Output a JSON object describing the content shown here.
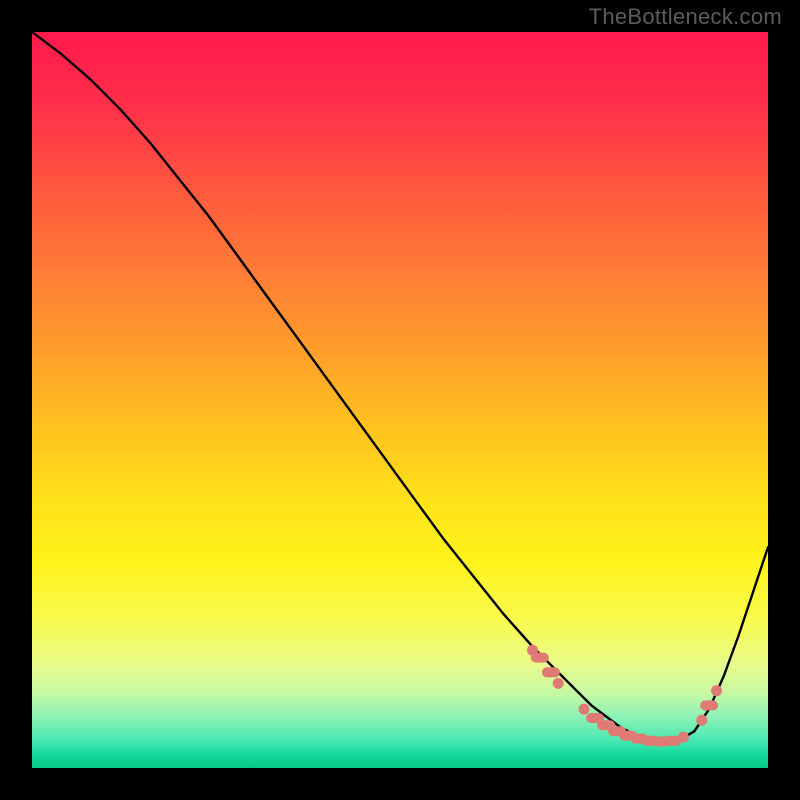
{
  "watermark": "TheBottleneck.com",
  "colors": {
    "background": "#000000",
    "curve": "#000000",
    "marker_fill": "#e07a74",
    "gradient_top": "#ff1a4d",
    "gradient_bottom": "#06c986"
  },
  "chart_data": {
    "type": "line",
    "title": "",
    "xlabel": "",
    "ylabel": "",
    "xlim": [
      0,
      100
    ],
    "ylim": [
      0,
      100
    ],
    "grid": false,
    "legend_position": "none",
    "series": [
      {
        "name": "curve",
        "x": [
          0,
          4,
          8,
          12,
          16,
          20,
          24,
          28,
          32,
          36,
          40,
          44,
          48,
          52,
          56,
          60,
          64,
          68,
          70,
          72,
          74,
          76,
          78,
          80,
          82,
          84,
          86,
          88,
          90,
          92,
          94,
          96,
          98,
          100
        ],
        "y": [
          100,
          97,
          93.5,
          89.5,
          85,
          80,
          75,
          69.5,
          64,
          58.5,
          53,
          47.5,
          42,
          36.5,
          31,
          26,
          21,
          16.5,
          14.5,
          12.5,
          10.5,
          8.5,
          7,
          5.5,
          4.5,
          3.8,
          3.5,
          3.8,
          5,
          8,
          12.5,
          18,
          24,
          30
        ]
      }
    ],
    "markers": [
      {
        "x": 68.0,
        "y": 16.0,
        "shape": "dot"
      },
      {
        "x": 69.0,
        "y": 15.0,
        "shape": "dash"
      },
      {
        "x": 70.5,
        "y": 13.0,
        "shape": "dash"
      },
      {
        "x": 71.5,
        "y": 11.5,
        "shape": "dot"
      },
      {
        "x": 75.0,
        "y": 8.0,
        "shape": "dot"
      },
      {
        "x": 76.5,
        "y": 6.8,
        "shape": "dash"
      },
      {
        "x": 78.0,
        "y": 5.8,
        "shape": "dash"
      },
      {
        "x": 79.5,
        "y": 5.0,
        "shape": "dash"
      },
      {
        "x": 81.0,
        "y": 4.4,
        "shape": "dash"
      },
      {
        "x": 82.5,
        "y": 4.0,
        "shape": "dash"
      },
      {
        "x": 84.0,
        "y": 3.7,
        "shape": "dash"
      },
      {
        "x": 85.5,
        "y": 3.6,
        "shape": "dash"
      },
      {
        "x": 87.0,
        "y": 3.7,
        "shape": "dash"
      },
      {
        "x": 88.5,
        "y": 4.2,
        "shape": "dot"
      },
      {
        "x": 91.0,
        "y": 6.5,
        "shape": "dot"
      },
      {
        "x": 92.0,
        "y": 8.5,
        "shape": "dash"
      },
      {
        "x": 93.0,
        "y": 10.5,
        "shape": "dot"
      }
    ]
  }
}
